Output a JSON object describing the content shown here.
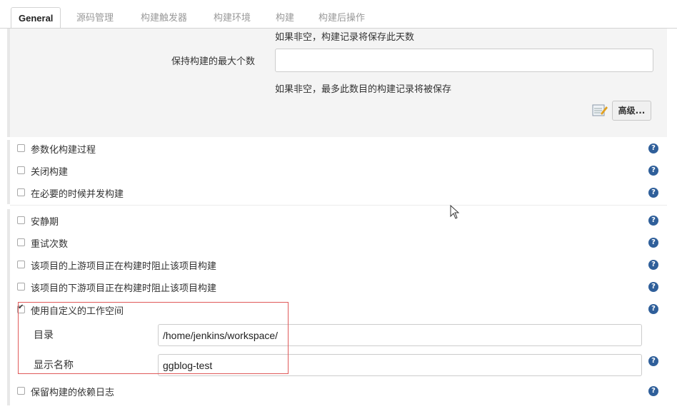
{
  "tabs": [
    "General",
    "源码管理",
    "构建触发器",
    "构建环境",
    "构建",
    "构建后操作"
  ],
  "top_hint": "如果非空，构建记录将保存此天数",
  "max_builds_label": "保持构建的最大个数",
  "max_builds_value": "",
  "max_builds_hint": "如果非空，最多此数目的构建记录将被保存",
  "advanced_button": "高级...",
  "options_group1": [
    {
      "label": "参数化构建过程",
      "checked": false
    },
    {
      "label": "关闭构建",
      "checked": false
    },
    {
      "label": "在必要的时候并发构建",
      "checked": false
    }
  ],
  "options_group2": [
    {
      "label": "安静期",
      "checked": false
    },
    {
      "label": "重试次数",
      "checked": false
    },
    {
      "label": "该项目的上游项目正在构建时阻止该项目构建",
      "checked": false
    },
    {
      "label": "该项目的下游项目正在构建时阻止该项目构建",
      "checked": false
    },
    {
      "label": "使用自定义的工作空间",
      "checked": true
    }
  ],
  "workspace": {
    "dir_label": "目录",
    "dir_value": "/home/jenkins/workspace/",
    "display_label": "显示名称",
    "display_value": "ggblog-test"
  },
  "last_option": {
    "label": "保留构建的依赖日志",
    "checked": false
  },
  "help_icon_glyph": "?",
  "help_color": "#2f5f9a"
}
